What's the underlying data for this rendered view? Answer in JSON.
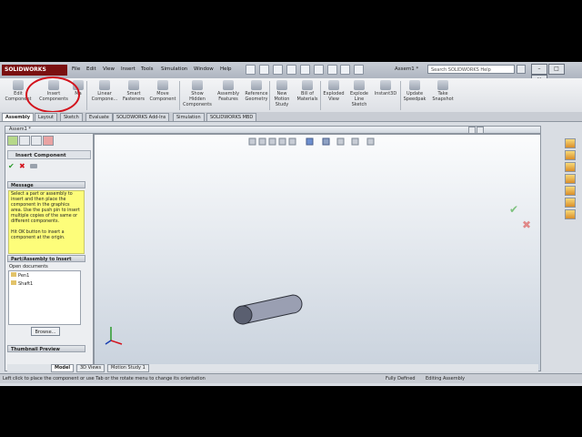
{
  "menu": {
    "logo": "SOLIDWORKS",
    "items": [
      "File",
      "Edit",
      "View",
      "Insert",
      "Tools",
      "Simulation",
      "Window",
      "Help"
    ],
    "doc_title": "Assem1 *",
    "search_placeholder": "Search SOLIDWORKS Help"
  },
  "ribbon": {
    "edit_component": "Edit\nComponent",
    "insert_components": "Insert\nComponents",
    "mate": "Ma",
    "linear_component": "Linear\nCompone...",
    "smart_fasteners": "Smart\nFasteners",
    "move_component": "Move\nComponent",
    "show_hidden": "Show\nHidden\nComponents",
    "assembly_features": "Assembly\nFeatures",
    "reference_geometry": "Reference\nGeometry",
    "new_motion_study": "New\nMotion\nStudy",
    "bill_of_materials": "Bill of\nMaterials",
    "exploded_view": "Exploded\nView",
    "explode_line_sketch": "Explode\nLine\nSketch",
    "instant3d": "Instant3D",
    "update_speedpak": "Update\nSpeedpak",
    "take_snapshot": "Take\nSnapshot"
  },
  "command_tabs": [
    "Assembly",
    "Layout",
    "Sketch",
    "Evaluate",
    "SOLIDWORKS Add-Ins",
    "Simulation",
    "SOLIDWORKS MBD"
  ],
  "document": {
    "name": "Assem1 *"
  },
  "property_manager": {
    "title": "Insert Component",
    "message_header": "Message",
    "message_text": "Select a part or assembly to insert and then place the component in the graphics area. Use the push pin to insert multiple copies of the same or different components.",
    "message_text2": "Hit OK button to insert a component at the origin.",
    "part_header": "Part/Assembly to Insert",
    "open_docs_label": "Open documents",
    "open_docs": [
      "Pen1",
      "Shaft1"
    ],
    "browse_label": "Browse...",
    "thumbnail_header": "Thumbnail Preview"
  },
  "bottom_tabs": [
    "Model",
    "3D Views",
    "Motion Study 1"
  ],
  "status": {
    "hint": "Left click to place the component or use Tab or the rotate menu to change its orientation",
    "state": "Fully Defined",
    "mode": "Editing Assembly"
  },
  "colors": {
    "accent_red": "#d3121c",
    "logo_bg": "#7a1010",
    "message_bg": "#fdfd7a",
    "shaft": "#8f95a8"
  },
  "icons": {
    "ok": "check-icon",
    "cancel": "close-icon",
    "pushpin": "pushpin-icon"
  }
}
